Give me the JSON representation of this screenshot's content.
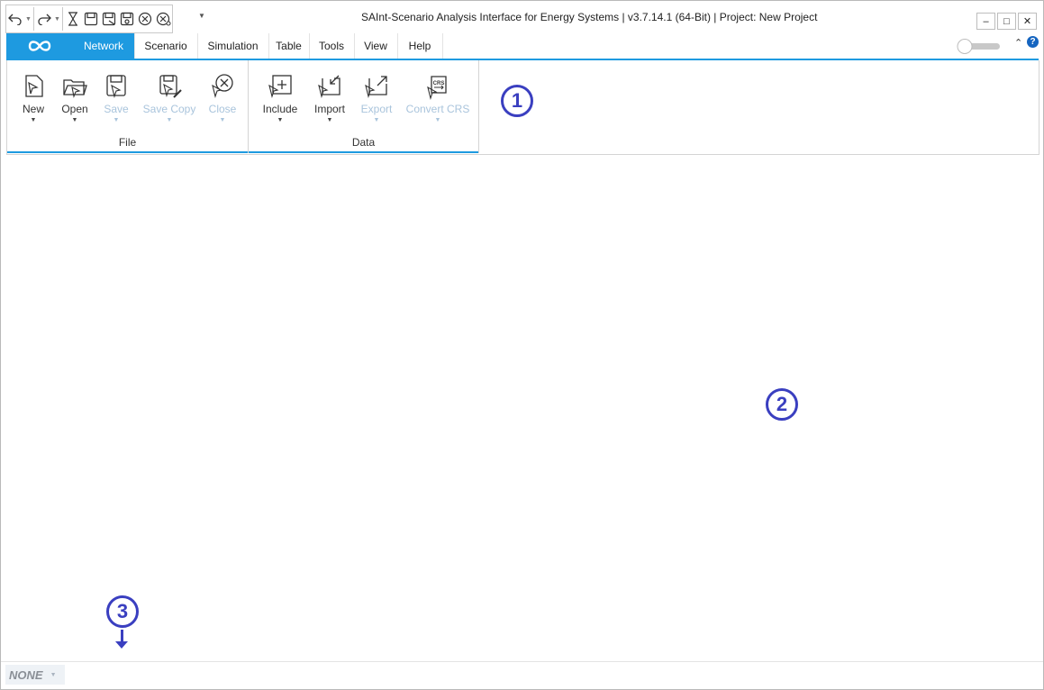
{
  "app": {
    "title": "SAInt-Scenario Analysis Interface for Energy Systems | v3.7.14.1 (64-Bit) | Project: New Project"
  },
  "window_controls": {
    "minimize": "–",
    "maximize": "□",
    "close": "✕"
  },
  "ribbon": {
    "tabs": [
      {
        "label": "Network",
        "active": true
      },
      {
        "label": "Scenario",
        "active": false
      },
      {
        "label": "Simulation",
        "active": false
      },
      {
        "label": "Table",
        "active": false
      },
      {
        "label": "Tools",
        "active": false
      },
      {
        "label": "View",
        "active": false
      },
      {
        "label": "Help",
        "active": false
      }
    ],
    "groups": [
      {
        "label": "File",
        "buttons": [
          {
            "label": "New",
            "enabled": true,
            "icon": "new-network-icon"
          },
          {
            "label": "Open",
            "enabled": true,
            "icon": "open-folder-icon"
          },
          {
            "label": "Save",
            "enabled": false,
            "icon": "save-icon"
          },
          {
            "label": "Save Copy",
            "enabled": false,
            "icon": "save-copy-icon"
          },
          {
            "label": "Close",
            "enabled": false,
            "icon": "close-network-icon"
          }
        ]
      },
      {
        "label": "Data",
        "buttons": [
          {
            "label": "Include",
            "enabled": true,
            "icon": "include-icon"
          },
          {
            "label": "Import",
            "enabled": true,
            "icon": "import-icon"
          },
          {
            "label": "Export",
            "enabled": false,
            "icon": "export-icon"
          },
          {
            "label": "Convert CRS",
            "enabled": false,
            "icon": "convert-crs-icon"
          }
        ]
      }
    ],
    "crs_badge": "CRS"
  },
  "callouts": [
    "1",
    "2",
    "3"
  ],
  "status": {
    "mode": "NONE"
  },
  "colors": {
    "accent": "#1e9ae0",
    "callout": "#3a3fc0",
    "disabled_text": "#a9c4dc"
  }
}
